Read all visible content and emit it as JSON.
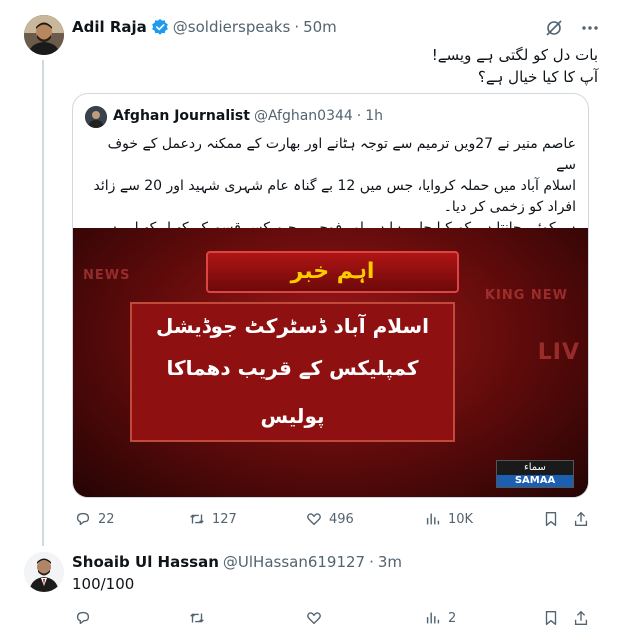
{
  "main_post": {
    "name": "Adil Raja",
    "handle": "@soldierspeaks",
    "time": "50m",
    "text_line1": "بات دل کو لگتی ہے ویسے!",
    "text_line2": "آپ کا کیا خیال ہے؟",
    "quoted": {
      "name": "Afghan Journalist",
      "handle": "@Afghan0344",
      "time": "1h",
      "text_line1": "عاصم منیر نے 27ویں ترمیم سے توجہ ہٹانے اور بھارت کے ممکنہ ردعمل کے خوف سے",
      "text_line2": "اسلام آباد میں حملہ کروایا، جس میں 12 بے گناہ عام شہری شہید اور 20 سے زائد",
      "text_line3": "افراد کو زخمی کر دیا۔",
      "text_line4": "ہر کوئی جانتا ہے کہ کیا چل رہا ہے اور فوجی رجیم کس قسم کے کھیل کھیل رہی ہے۔",
      "media": {
        "banner": "اہم خبر",
        "line1": "اسلام آباد ڈسٹرکٹ جوڈیشل",
        "line2": "کمپلیکس کے قریب دھماکا",
        "line3": "پولیس",
        "bg_word1": "NEWS",
        "bg_word2": "KING NEW",
        "bg_word3": "LIV",
        "logo_top": "سماء",
        "logo_bottom": "SAMAA"
      }
    },
    "actions": {
      "replies": "22",
      "reposts": "127",
      "likes": "496",
      "views": "10K"
    }
  },
  "reply_post": {
    "name": "Shoaib Ul Hassan",
    "handle": "@UlHassan619127",
    "time": "3m",
    "text": "100/100",
    "actions": {
      "views": "2"
    }
  },
  "colors": {
    "verified": "#1d9bf0",
    "text": "#0f1419",
    "secondary": "#536471",
    "border": "#cfd9de",
    "media_red": "#8e1010",
    "media_gold": "#ffcc00"
  }
}
